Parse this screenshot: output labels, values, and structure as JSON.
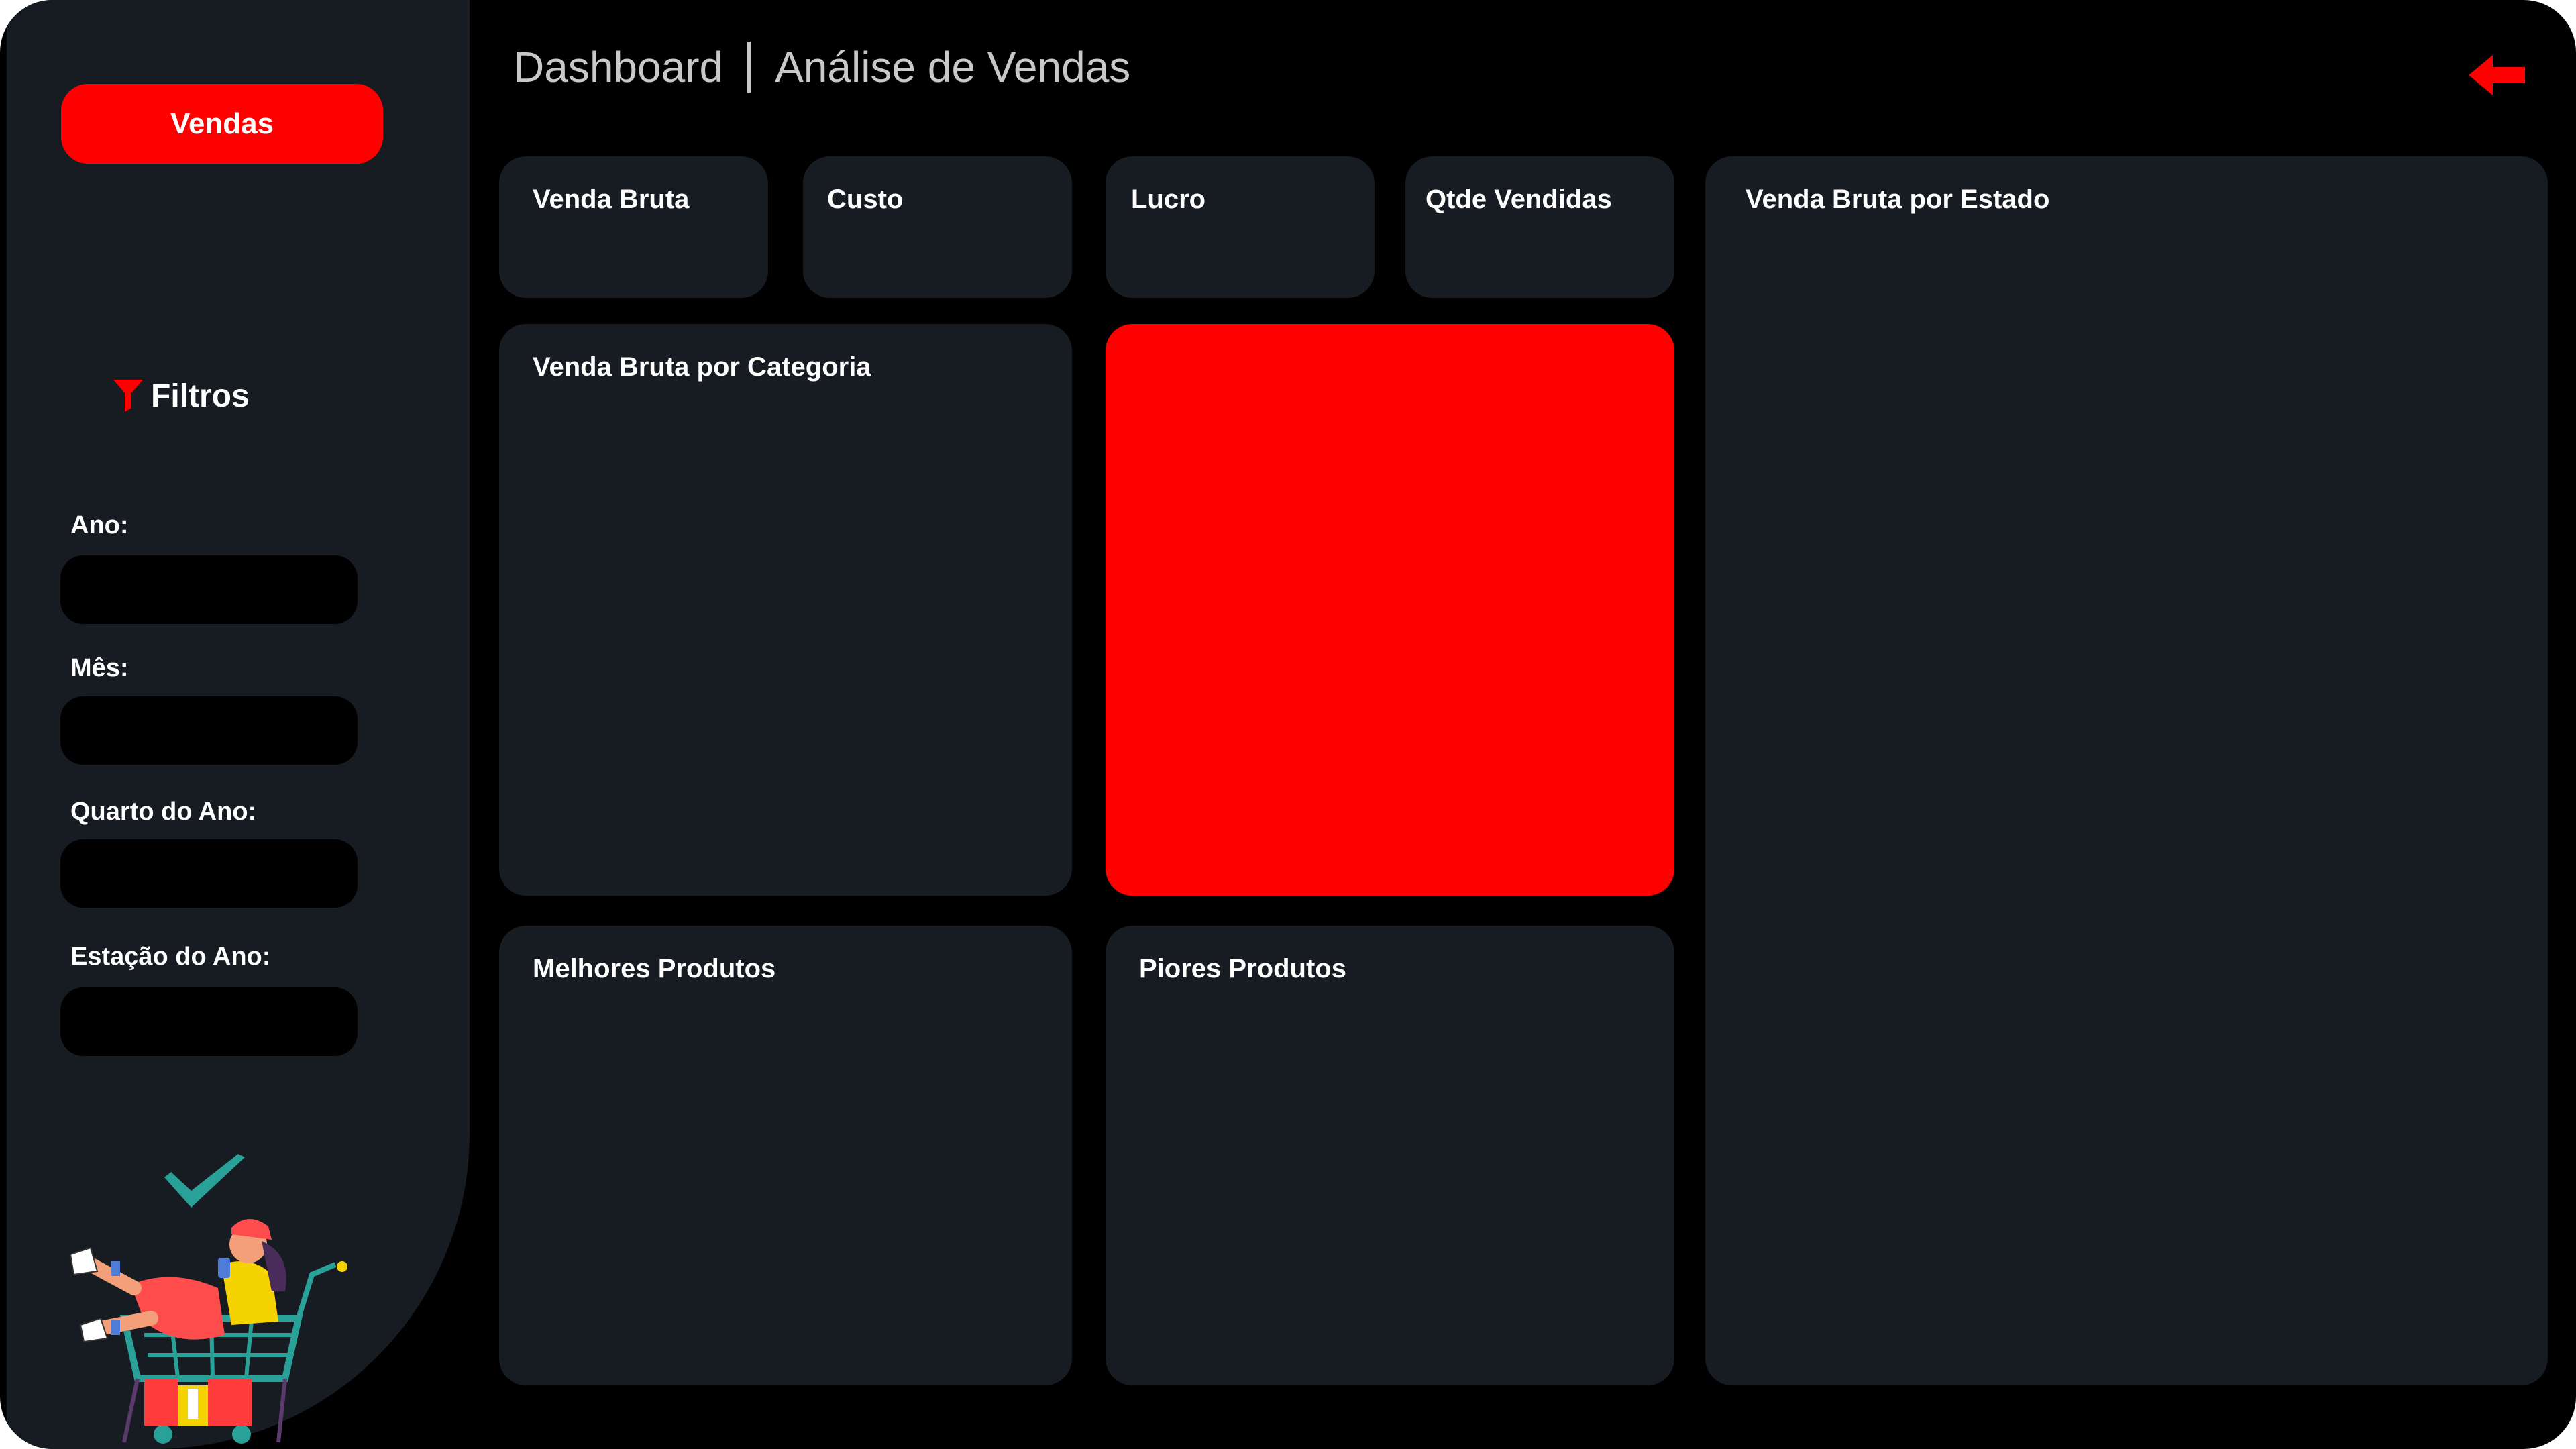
{
  "sidebar": {
    "primary_button": "Vendas",
    "filters_title": "Filtros",
    "filters": [
      {
        "label": "Ano:"
      },
      {
        "label": "Mês:"
      },
      {
        "label": "Quarto do Ano:"
      },
      {
        "label": "Estação do Ano:"
      }
    ]
  },
  "header": {
    "title": "Dashboard",
    "subtitle": "Análise de Vendas"
  },
  "kpis": {
    "venda_bruta": "Venda Bruta",
    "custo": "Custo",
    "lucro": "Lucro",
    "qtde": "Qtde Vendidas"
  },
  "panels": {
    "categoria": "Venda Bruta por Categoria",
    "estado": "Venda Bruta por Estado",
    "melhores": "Melhores Produtos",
    "piores": "Piores Produtos"
  },
  "colors": {
    "accent": "#ff0000",
    "card_bg": "#171b22",
    "page_bg": "#000000",
    "header_text": "#c8c8c8"
  },
  "icons": {
    "filter": "funnel-icon",
    "back": "arrow-left-icon"
  }
}
